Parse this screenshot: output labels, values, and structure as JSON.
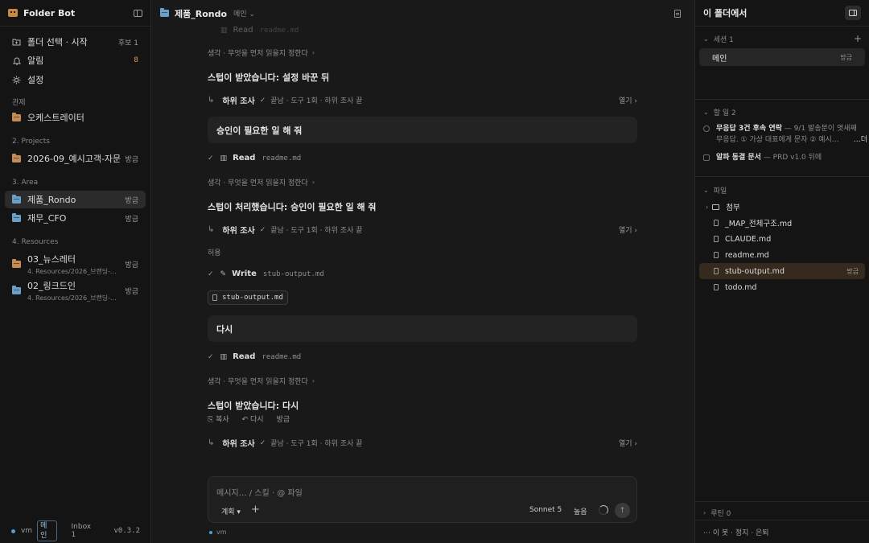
{
  "sidebar": {
    "app_title": "Folder Bot",
    "items": [
      {
        "label": "폴더 선택 · 시작",
        "meta": "후보 1"
      },
      {
        "label": "알림",
        "meta": "8"
      },
      {
        "label": "설정",
        "meta": ""
      }
    ],
    "sections": {
      "manage": "관제",
      "projects": "2. Projects",
      "area": "3. Area",
      "resources": "4. Resources"
    },
    "orchestrator": {
      "label": "오케스트레이터"
    },
    "projects": [
      {
        "label": "2026-09_예시고객-자문",
        "meta": "방금"
      }
    ],
    "area": [
      {
        "label": "제품_Rondo",
        "meta": "방금"
      },
      {
        "label": "재무_CFO",
        "meta": "방금"
      }
    ],
    "resources": [
      {
        "label": "03_뉴스레터",
        "sub": "4. Resources/2026_브랜딩-...",
        "meta": "방금"
      },
      {
        "label": "02_링크드인",
        "sub": "4. Resources/2026_브랜딩-...",
        "meta": "방금"
      }
    ],
    "footer": {
      "host": "vm",
      "tag": "메인",
      "inbox": "Inbox 1",
      "version": "v0.3.2"
    }
  },
  "main": {
    "title": "제품_Rondo",
    "branch": "메인",
    "top_read": {
      "tool": "Read",
      "file": "readme.md"
    },
    "think_text": "생각 · 무엇을 먼저 읽을지 정한다",
    "sub_label": "하위 조사",
    "sub_detail": "끝남 · 도구 1회 · 하위 조사 끝",
    "open_label": "열기",
    "messages": {
      "a1": "스텁이 받았습니다: 설정 바꾼 뒤",
      "u1": "승인이 필요한 일 해 줘",
      "a2": "스텁이 처리했습니다: 승인이 필요한 일 해 줘",
      "allow": "허용",
      "u2": "다시",
      "a3": "스텁이 받았습니다: 다시"
    },
    "tools": {
      "read": "Read",
      "read_file": "readme.md",
      "write": "Write",
      "write_file": "stub-output.md",
      "chip": "stub-output.md"
    },
    "actions": {
      "copy": "복사",
      "retry": "다시",
      "time": "방금"
    },
    "composer": {
      "placeholder": "메시지… / 스킬 · @ 파일",
      "plan": "계획 ▾",
      "model": "Sonnet 5",
      "effort": "높음"
    },
    "vm_tag": "vm"
  },
  "right": {
    "title": "이 폴더에서",
    "sessions": {
      "label": "세션 1",
      "item": "메인",
      "meta": "방금"
    },
    "todos": {
      "label": "할 일 2",
      "items": [
        {
          "title": "무응답 3건 후속 연락",
          "desc": " — 9/1 발송분이 엿새째 무응답. ① 가상 대표에게 문자 ② 예시…"
        },
        {
          "title": "알파 동결 문서",
          "desc": " — PRD v1.0 뒤에"
        }
      ],
      "more": "…더"
    },
    "files": {
      "label": "파일",
      "folder": "첨부",
      "items": [
        {
          "label": "_MAP_전체구조.md",
          "meta": ""
        },
        {
          "label": "CLAUDE.md",
          "meta": ""
        },
        {
          "label": "readme.md",
          "meta": ""
        },
        {
          "label": "stub-output.md",
          "meta": "방금"
        },
        {
          "label": "todo.md",
          "meta": ""
        }
      ]
    },
    "routines": {
      "label": "루틴 0"
    },
    "footer": "⋯ 이 봇 · 정지 · 은퇴"
  },
  "colors": {
    "accent_orange": "#e39a4c",
    "folder_orange": "#c58b54",
    "folder_blue": "#6aa1c9",
    "active_file_bg": "#36291d"
  }
}
